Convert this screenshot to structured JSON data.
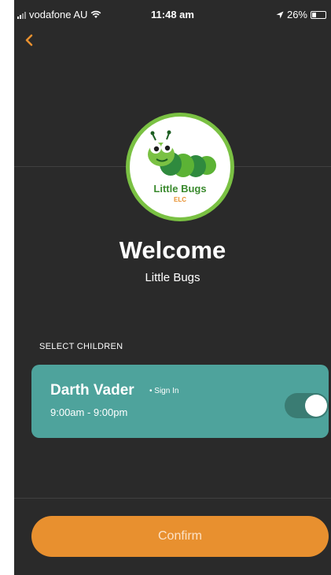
{
  "status_bar": {
    "carrier": "vodafone AU",
    "time": "11:48 am",
    "battery": "26%",
    "icons": [
      "signal-icon",
      "wifi-icon",
      "location-arrow-icon",
      "battery-icon"
    ]
  },
  "nav": {
    "back_icon": "chevron-left-icon"
  },
  "logo": {
    "name": "Little Bugs",
    "sub": "ELC"
  },
  "welcome": {
    "title": "Welcome",
    "subtitle": "Little Bugs"
  },
  "children": {
    "section_label": "SELECT CHILDREN",
    "items": [
      {
        "name": "Darth Vader",
        "action": "• Sign In",
        "hours": "9:00am - 9:00pm",
        "selected": true
      }
    ]
  },
  "footer": {
    "confirm_label": "Confirm"
  },
  "colors": {
    "background": "#2a2a2a",
    "accent": "#e8902f",
    "card": "#4ea39c",
    "logo_ring": "#7ac143"
  }
}
